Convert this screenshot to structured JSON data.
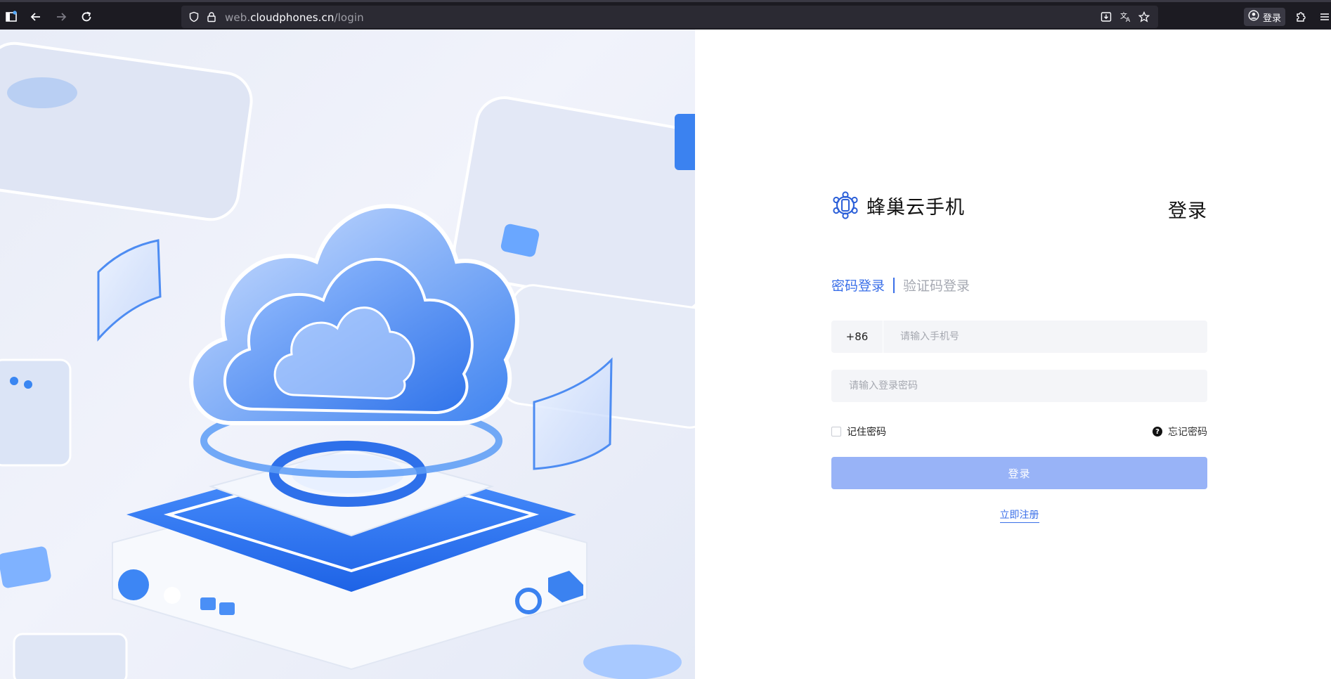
{
  "browser": {
    "url_host": "web.cloudphones.cn",
    "url_path": "/login",
    "account_label": "登录"
  },
  "brand": {
    "name": "蜂巢云手机",
    "accent_color": "#3a6fe8"
  },
  "login": {
    "title": "登录",
    "tabs": [
      {
        "label": "密码登录",
        "active": true
      },
      {
        "label": "验证码登录",
        "active": false
      }
    ],
    "phone_prefix": "+86",
    "phone_placeholder": "请输入手机号",
    "password_placeholder": "请输入登录密码",
    "remember_label": "记住密码",
    "remember_checked": false,
    "forgot_label": "忘记密码",
    "submit_label": "登录",
    "register_label": "立即注册"
  },
  "icons": {
    "sidebar": "sidebar-icon",
    "back": "arrow-left-icon",
    "forward": "arrow-right-icon",
    "reload": "reload-icon",
    "shield": "shield-icon",
    "lock": "lock-icon",
    "download": "download-icon",
    "translate": "translate-icon",
    "bookmark": "star-icon",
    "account": "account-icon",
    "extensions": "puzzle-icon",
    "menu": "menu-icon",
    "help": "question-icon"
  }
}
